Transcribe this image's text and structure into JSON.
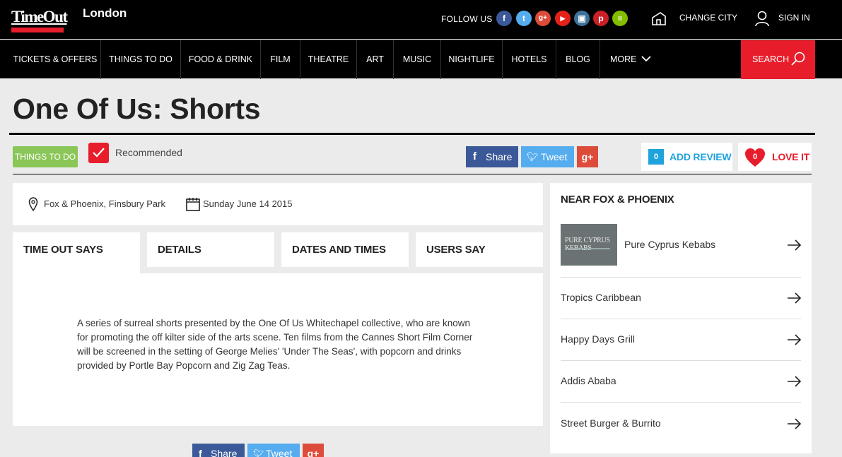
{
  "header": {
    "logo_text": "TimeOut",
    "city": "London",
    "follow_label": "FOLLOW US",
    "social": [
      {
        "icon": "facebook-icon",
        "glyph": "f",
        "color": "#3b5998"
      },
      {
        "icon": "twitter-icon",
        "glyph": "t",
        "color": "#55acee"
      },
      {
        "icon": "google-plus-icon",
        "glyph": "g+",
        "color": "#dd4b39"
      },
      {
        "icon": "youtube-icon",
        "glyph": "▶",
        "color": "#e62117"
      },
      {
        "icon": "instagram-icon",
        "glyph": "▣",
        "color": "#3f729b"
      },
      {
        "icon": "pinterest-icon",
        "glyph": "p",
        "color": "#cb2027"
      },
      {
        "icon": "spotify-icon",
        "glyph": "≡",
        "color": "#84bd00"
      }
    ],
    "change_city": "CHANGE CITY",
    "sign_in": "SIGN IN"
  },
  "nav": {
    "items": [
      "TICKETS & OFFERS",
      "THINGS TO DO",
      "FOOD & DRINK",
      "FILM",
      "THEATRE",
      "ART",
      "MUSIC",
      "NIGHTLIFE",
      "HOTELS",
      "BLOG",
      "MORE"
    ],
    "search": "SEARCH"
  },
  "page": {
    "title": "One Of Us: Shorts",
    "category_tag": "THINGS TO DO",
    "recommended": "Recommended",
    "share": {
      "facebook": "Share",
      "twitter": "Tweet",
      "google": "g+"
    },
    "review_count": "0",
    "add_review": "ADD REVIEW",
    "love_count": "0",
    "love_it": "LOVE IT"
  },
  "info": {
    "venue": "Fox & Phoenix, Finsbury Park",
    "date": "Sunday June 14 2015"
  },
  "tabs": [
    "TIME OUT SAYS",
    "DETAILS",
    "DATES AND TIMES",
    "USERS SAY"
  ],
  "description": "A series of surreal shorts presented by the One Of Us Whitechapel collective, who are known for promoting the off kilter side of the arts scene. Ten films from the Cannes Short Film Corner will be screened in the setting of George Melies' 'Under The Seas', with popcorn and drinks provided by Portle Bay Popcorn and Zig Zag Teas.",
  "sidebar": {
    "title": "NEAR FOX & PHOENIX",
    "thumb_text": "PURE CYPRUS KEBABS",
    "items": [
      "Pure Cyprus Kebabs",
      "Tropics Caribbean",
      "Happy Days Grill",
      "Addis Ababa",
      "Street Burger & Burrito"
    ]
  },
  "colors": {
    "accent": "#e81d2b",
    "tag_green": "#8bc658",
    "review_blue": "#1fa3dc"
  }
}
